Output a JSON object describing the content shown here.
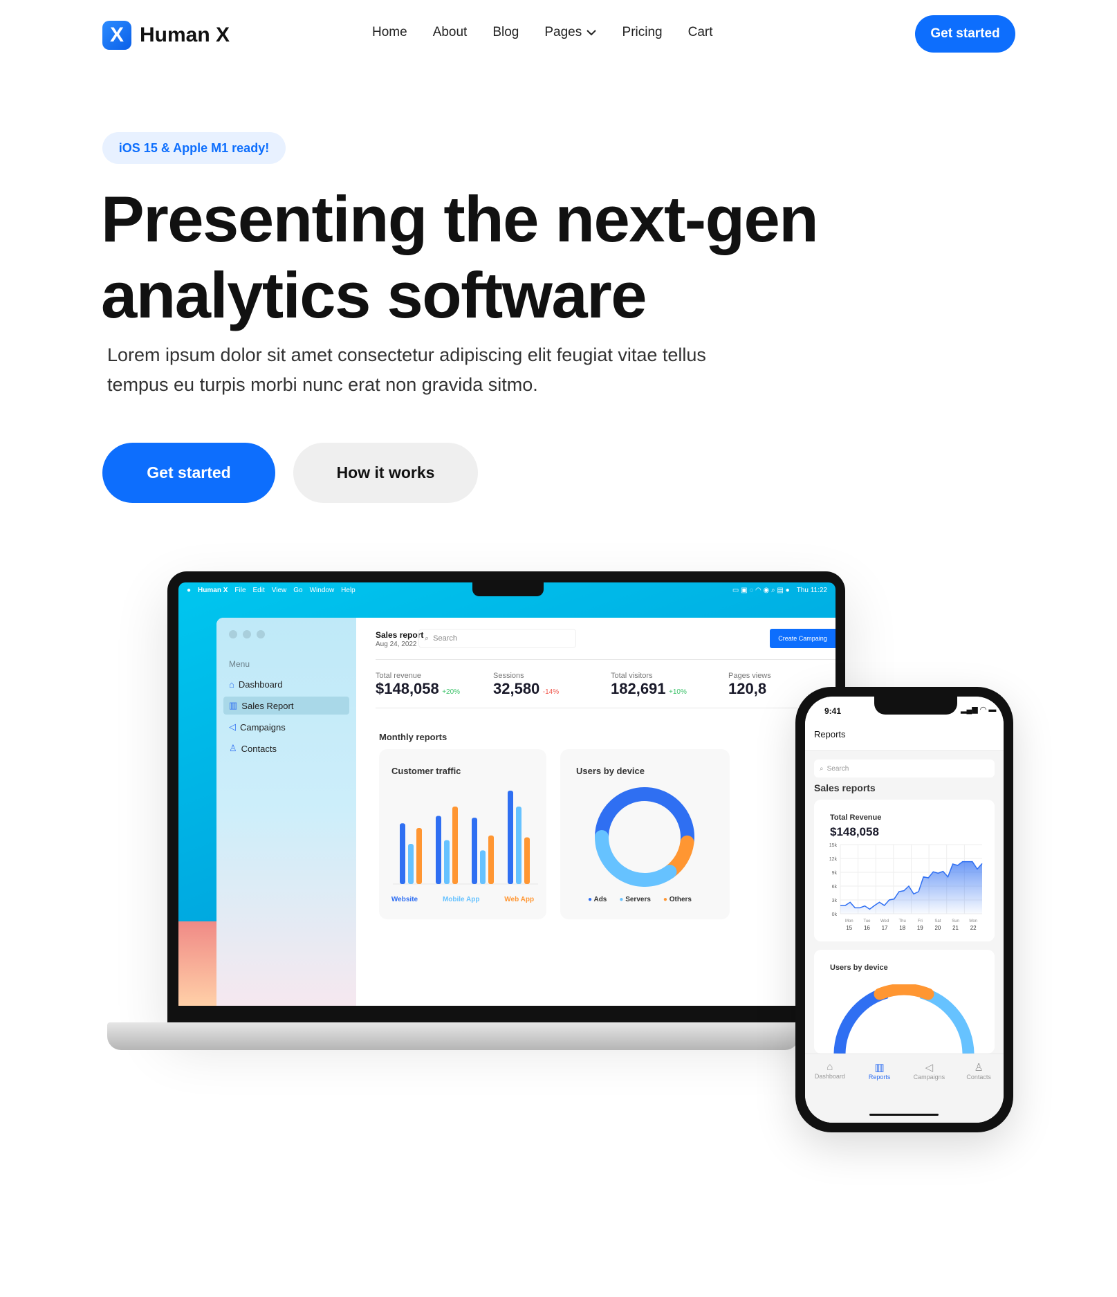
{
  "brand": {
    "name": "Human X",
    "mark": "X",
    "accent": "#0d6efd"
  },
  "nav": {
    "items": [
      "Home",
      "About",
      "Blog",
      "Pages",
      "Pricing",
      "Cart"
    ],
    "cta": "Get started"
  },
  "hero": {
    "badge": "iOS 15 & Apple M1 ready!",
    "title_line1": "Presenting the next-gen",
    "title_line2": "analytics software",
    "lead_line1": "Lorem ipsum dolor sit amet consectetur adipiscing elit feugiat vitae tellus",
    "lead_line2": "tempus eu turpis morbi nunc erat non gravida sitmo.",
    "primary": "Get started",
    "secondary": "How it works"
  },
  "laptop": {
    "menubar": {
      "items": [
        "Human X",
        "File",
        "Edit",
        "View",
        "Go",
        "Window",
        "Help"
      ],
      "clock": "Thu 11:22"
    },
    "sidebar": {
      "heading": "Menu",
      "items": [
        {
          "label": "Dashboard",
          "icon": "home-icon"
        },
        {
          "label": "Sales Report",
          "icon": "chart-icon",
          "active": true
        },
        {
          "label": "Campaigns",
          "icon": "megaphone-icon"
        },
        {
          "label": "Contacts",
          "icon": "user-icon"
        }
      ]
    },
    "header": {
      "title": "Sales report",
      "date": "Aug 24, 2022",
      "search_placeholder": "Search",
      "create": "Create Campaing"
    },
    "stats": [
      {
        "label": "Total revenue",
        "value": "$148,058",
        "delta": "+20%",
        "up": true
      },
      {
        "label": "Sessions",
        "value": "32,580",
        "delta": "-14%",
        "up": false
      },
      {
        "label": "Total visitors",
        "value": "182,691",
        "delta": "+10%",
        "up": true
      },
      {
        "label": "Pages views",
        "value": "120,8"
      }
    ],
    "section": "Monthly reports",
    "traffic": {
      "title": "Customer traffic",
      "legend": [
        "Website",
        "Mobile App",
        "Web App"
      ]
    },
    "device": {
      "title": "Users by device",
      "legend": [
        "Ads",
        "Servers",
        "Others"
      ]
    }
  },
  "phone": {
    "time": "9:41",
    "title": "Reports",
    "search_placeholder": "Search",
    "section": "Sales reports",
    "revenue_label": "Total Revenue",
    "revenue_value": "$148,058",
    "device_title": "Users by device",
    "tabs": [
      "Dashboard",
      "Reports",
      "Campaigns",
      "Contacts"
    ],
    "active_tab": "Reports"
  },
  "chart_data": [
    {
      "type": "bar",
      "title": "Customer traffic",
      "series": [
        {
          "name": "Website",
          "color": "#2f6ff2",
          "values": [
            65,
            73,
            71,
            100
          ]
        },
        {
          "name": "Mobile App",
          "color": "#66c2ff",
          "values": [
            43,
            47,
            36,
            83
          ]
        },
        {
          "name": "Web App",
          "color": "#ff9632",
          "values": [
            60,
            83,
            52,
            50
          ]
        }
      ]
    },
    {
      "type": "pie",
      "title": "Users by device",
      "donut": true,
      "categories": [
        "Ads",
        "Servers",
        "Others"
      ],
      "values": [
        52,
        35,
        13
      ],
      "colors": [
        "#2f6ff2",
        "#66c2ff",
        "#ff9632"
      ]
    },
    {
      "type": "area",
      "title": "Total Revenue",
      "yticks": [
        "15k",
        "12k",
        "9k",
        "6k",
        "3k",
        "0k"
      ],
      "ylim": [
        0,
        15
      ],
      "x_days": [
        "Mon",
        "Tue",
        "Wed",
        "Thu",
        "Fri",
        "Sat",
        "Sun",
        "Mon"
      ],
      "x_dates": [
        "15",
        "16",
        "17",
        "18",
        "19",
        "20",
        "21",
        "22"
      ],
      "values": [
        1.8,
        1.8,
        2.5,
        1.3,
        1.3,
        1.7,
        1.0,
        1.8,
        2.5,
        1.8,
        3.0,
        3.2,
        4.8,
        5.0,
        6.0,
        4.3,
        4.8,
        8.0,
        7.8,
        9.1,
        8.8,
        9.2,
        8.0,
        10.8,
        10.5,
        11.3,
        11.3,
        11.3,
        9.7,
        10.9
      ]
    }
  ]
}
